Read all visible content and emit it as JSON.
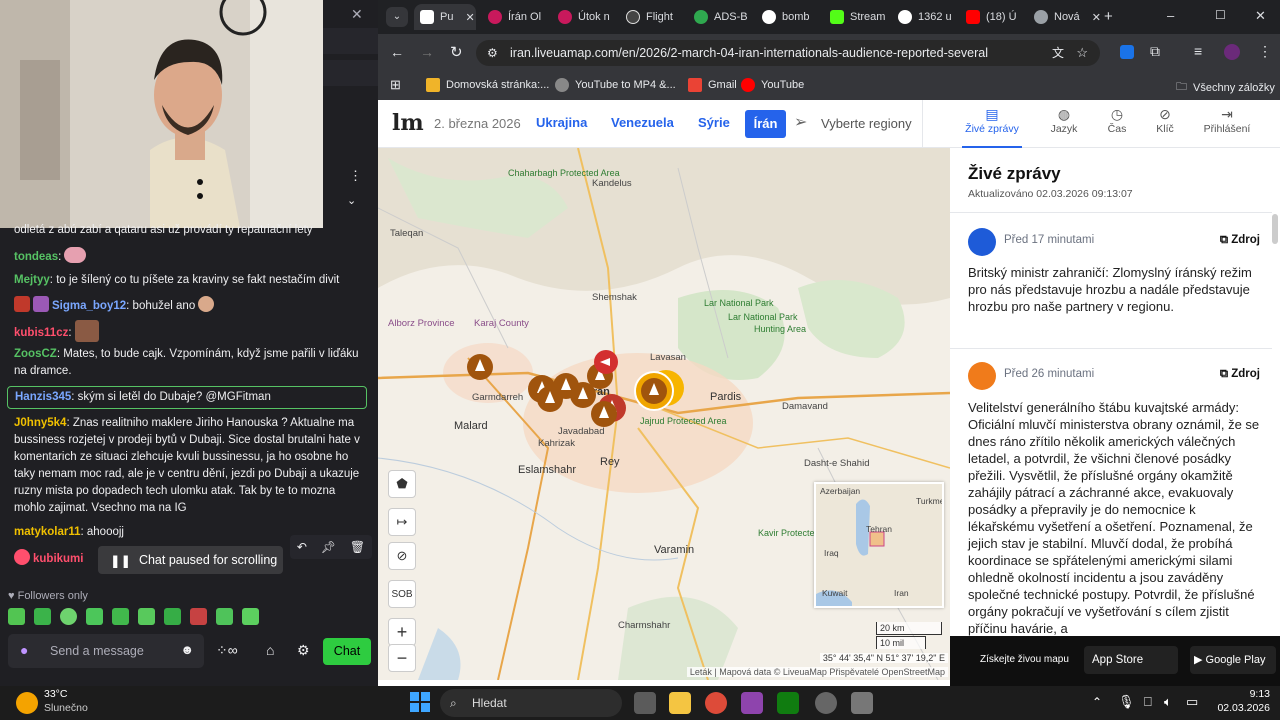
{
  "chat": {
    "partial_top": "odletá z abú zabí a qataru asi už provádí ty repatriační lety",
    "messages": [
      {
        "user": "tondeas",
        "color": "#56c264",
        "text": ""
      },
      {
        "user": "Mejtyy",
        "color": "#56c264",
        "text": "to je šílený co tu píšete za kraviny se fakt nestačím divit"
      },
      {
        "user": "Sigma_boy12",
        "color": "#7aa7ff",
        "text": "bohužel ano"
      },
      {
        "user": "kubis11cz",
        "color": "#ff4f6d",
        "text": ""
      },
      {
        "user": "ZoosCZ",
        "color": "#56c264",
        "text": "Mates, to bude cajk. Vzpomínám, když jsme pařili v liďáku na dramce."
      },
      {
        "user": "Hanzis345",
        "color": "#7aa7ff",
        "text": "ským si letěl do Dubaje? @MGFitman"
      },
      {
        "user": "J0hny5k4",
        "color": "#f0c000",
        "text": "Znas realitniho maklere Jiriho Hanouska ? Aktualne ma bussiness rozjetej v prodeji bytů v Dubaji. Sice dostal brutalni hate v komentarich ze situaci zlehcuje kvuli bussinessu, ja ho osobne ho taky nemam moc rad, ale je v centru dění, jezdi po Dubaji a ukazuje ruzny mista po dopadech tech ulomku atak. Tak by te to mozna mohlo zajimat. Vsechno ma na IG"
      },
      {
        "user": "matykolar11",
        "color": "#f0c000",
        "text": "ahooojj"
      },
      {
        "user": "kubikumi",
        "color": "#ff4f6d",
        "text": ""
      }
    ],
    "paused_label": "Chat paused for scrolling",
    "followers_only": "Followers only",
    "input_placeholder": "Send a message",
    "chat_button": "Chat"
  },
  "browser": {
    "tabs": [
      "Pu",
      "Írán Ol",
      "Útok n",
      "Flight",
      "ADS-B",
      "bomb",
      "Stream",
      "1362 u",
      "(18) Ú",
      "Nová"
    ],
    "url": "iran.liveuamap.com/en/2026/2-march-04-iran-internationals-audience-reported-several",
    "bookmarks": [
      "Domovská stránka:...",
      "YouTube to MP4 &...",
      "Gmail",
      "YouTube"
    ],
    "all_bookmarks": "Všechny záložky"
  },
  "site": {
    "logo": "lm",
    "date": "2. března 2026",
    "nav": [
      "Ukrajina",
      "Venezuela",
      "Sýrie",
      "Írán"
    ],
    "region_select": "Vyberte regiony",
    "right_tabs": [
      "Živé zprávy",
      "Jazyk",
      "Čas",
      "Klíč",
      "Přihlášení"
    ]
  },
  "map": {
    "labels": [
      "Kandelus",
      "Taleqan",
      "Shemshak",
      "Alborz Province",
      "Karaj County",
      "Lavasan",
      "Pardis",
      "Damavand",
      "Garmdarreh",
      "Malard",
      "Tehran",
      "Eslamshahr",
      "Rey",
      "Varamin",
      "Charmshahr",
      "Jajrud Protected Area",
      "Lar National Park",
      "Hunting Area",
      "Dasht-e Shahid",
      "Javadabad",
      "Kahrizak"
    ],
    "green_labels": [
      "Chaharbagh Protected Area",
      "Lar National Park",
      "Kavir Protected Area"
    ],
    "control_sob": "SOB",
    "scale": [
      "20 km",
      "10 mil"
    ],
    "coords": "35° 44' 35,4\" N 51° 37' 19,2\" E",
    "attribution": "Leták | Mapová data © LiveuaMap Přispěvatelé OpenStreetMap",
    "minimap_labels": [
      "Azerbaijan",
      "Turkmenistan",
      "Tehran",
      "Iraq",
      "Kuwait",
      "Iran"
    ]
  },
  "news": {
    "title": "Živé zprávy",
    "updated": "Aktualizováno 02.03.2026 09:13:07",
    "items": [
      {
        "time": "Před 17 minutami",
        "source": "Zdroj",
        "badge": "#1e5bd8",
        "text": "Britský ministr zahraničí: Zlomyslný íránský režim pro nás představuje hrozbu a nadále představuje hrozbu pro naše partnery v regionu."
      },
      {
        "time": "Před 26 minutami",
        "source": "Zdroj",
        "badge": "#f07b1b",
        "text": "Velitelství generálního štábu kuvajtské armády: Oficiální mluvčí ministerstva obrany oznámil, že se dnes ráno zřítilo několik amerických válečných letadel, a potvrdil, že všichni členové posádky přežili. Vysvětlil, že příslušné orgány okamžitě zahájily pátrací a záchranné akce, evakuovaly posádky a přepravily je do nemocnice k lékařskému vyšetření a ošetření. Poznamenal, že jejich stav je stabilní. Mluvčí dodal, že probíhá koordinace se spřátelenými americkými silami ohledně okolností incidentu a jsou zaváděny společné technické postupy. Potvrdil, že příslušné orgány pokračují ve vyšetřování s cílem zjistit příčinu havárie, a"
      }
    ]
  },
  "appbar": {
    "cta": "Získejte živou mapu",
    "appstore": "App Store",
    "gplay": "Google Play"
  },
  "taskbar": {
    "weather_temp": "33°C",
    "weather_desc": "Slunečno",
    "search": "Hledat",
    "time": "9:13",
    "date": "02.03.2026"
  }
}
